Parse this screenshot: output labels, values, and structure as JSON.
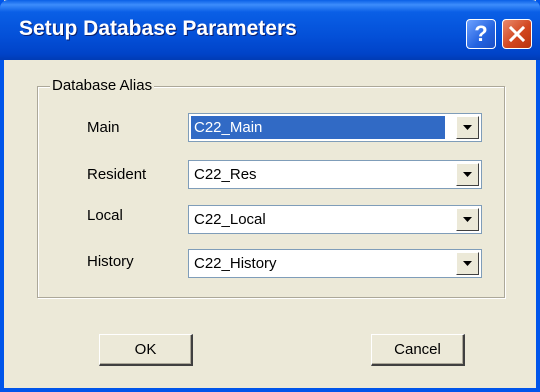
{
  "window": {
    "title": "Setup Database Parameters",
    "help_glyph": "?",
    "help_icon": "help-icon",
    "close_icon": "close-icon"
  },
  "group": {
    "label": "Database Alias",
    "fields": [
      {
        "label": "Main",
        "value": "C22_Main",
        "selected": true
      },
      {
        "label": "Resident",
        "value": "C22_Res",
        "selected": false
      },
      {
        "label": "Local",
        "value": "C22_Local",
        "selected": false
      },
      {
        "label": "History",
        "value": "C22_History",
        "selected": false
      }
    ]
  },
  "buttons": {
    "ok_label": "OK",
    "cancel_label": "Cancel"
  },
  "colors": {
    "titlebar": "#0450d8",
    "selection": "#316ac5",
    "dialog_bg": "#ece9d8",
    "close_button": "#d2461f"
  }
}
